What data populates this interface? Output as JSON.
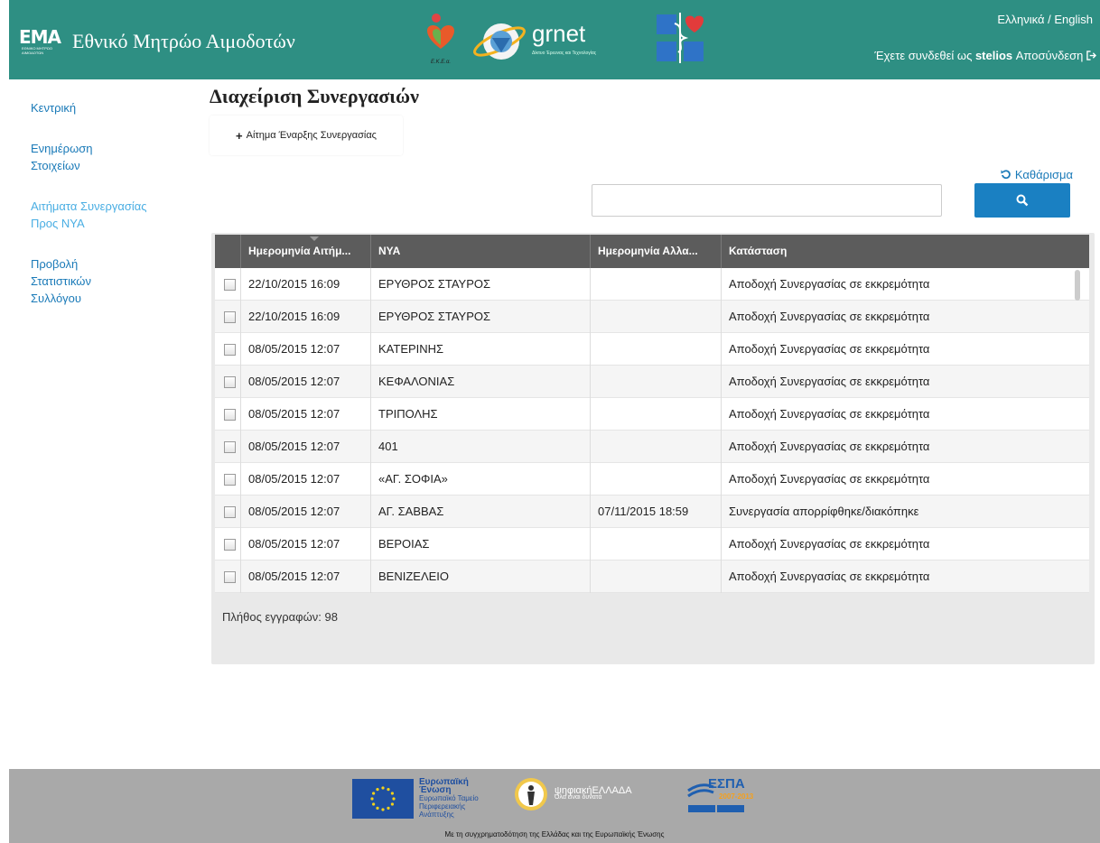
{
  "header": {
    "logo_abbr": "EMA",
    "logo_tiny": "ΕΘΝΙΚΟ ΜΗΤΡΩΟ ΑΙΜΟΔΟΤΩΝ",
    "title": "Εθνικό Μητρώο Αιμοδοτών",
    "partner_ekea": "Ε.Κ.Ε.α.",
    "partner_grnet": "grnet",
    "partner_grnet_sub": "Δίκτυο Έρευνας και Τεχνολογίας",
    "lang_el": "Ελληνικά",
    "lang_sep": " / ",
    "lang_en": "English",
    "login_prefix": "Έχετε συνδεθεί ως ",
    "login_user": "stelios",
    "logout": "Αποσύνδεση"
  },
  "sidebar": {
    "items": [
      {
        "label": "Κεντρική",
        "active": false
      },
      {
        "label": "Ενημέρωση Στοιχείων",
        "active": false
      },
      {
        "label": "Αιτήματα Συνεργασίας Προς ΝΥΑ",
        "active": true
      },
      {
        "label": "Προβολή Στατιστικών Συλλόγου",
        "active": false
      }
    ]
  },
  "main": {
    "title": "Διαχείριση Συνεργασιών",
    "request_button": "Αίτημα Έναρξης Συνεργασίας",
    "clear_label": "Καθάρισμα",
    "search_value": "",
    "search_placeholder": ""
  },
  "grid": {
    "columns": [
      "Ημερομηνία Αιτήμ...",
      "ΝΥΑ",
      "Ημερομηνία Αλλα...",
      "Κατάσταση"
    ],
    "rows": [
      [
        "22/10/2015 16:09",
        "ΕΡΥΘΡΟΣ ΣΤΑΥΡΟΣ",
        "",
        "Αποδοχή Συνεργασίας σε εκκρεμότητα"
      ],
      [
        "22/10/2015 16:09",
        "ΕΡΥΘΡΟΣ ΣΤΑΥΡΟΣ",
        "",
        "Αποδοχή Συνεργασίας σε εκκρεμότητα"
      ],
      [
        "08/05/2015 12:07",
        "ΚΑΤΕΡΙΝΗΣ",
        "",
        "Αποδοχή Συνεργασίας σε εκκρεμότητα"
      ],
      [
        "08/05/2015 12:07",
        "ΚΕΦΑΛΟΝΙΑΣ",
        "",
        "Αποδοχή Συνεργασίας σε εκκρεμότητα"
      ],
      [
        "08/05/2015 12:07",
        "ΤΡΙΠΟΛΗΣ",
        "",
        "Αποδοχή Συνεργασίας σε εκκρεμότητα"
      ],
      [
        "08/05/2015 12:07",
        "401",
        "",
        "Αποδοχή Συνεργασίας σε εκκρεμότητα"
      ],
      [
        "08/05/2015 12:07",
        "«ΑΓ. ΣΟΦΙΑ»",
        "",
        "Αποδοχή Συνεργασίας σε εκκρεμότητα"
      ],
      [
        "08/05/2015 12:07",
        "ΑΓ. ΣΑΒΒΑΣ",
        "07/11/2015 18:59",
        "Συνεργασία απορρίφθηκε/διακόπηκε"
      ],
      [
        "08/05/2015 12:07",
        "ΒΕΡΟΙΑΣ",
        "",
        "Αποδοχή Συνεργασίας σε εκκρεμότητα"
      ],
      [
        "08/05/2015 12:07",
        "ΒΕΝΙΖΕΛΕΙΟ",
        "",
        "Αποδοχή Συνεργασίας σε εκκρεμότητα"
      ]
    ],
    "record_count": "Πλήθος εγγραφών: 98"
  },
  "footer": {
    "eu_title": "Ευρωπαϊκή Ένωση",
    "eu_sub": "Ευρωπαϊκό Ταμείο Περιφερειακής Ανάπτυξης",
    "digital_title": "ψηφιακήΕΛΛΑΔΑ",
    "digital_sub": "Όλα είναι δυνατά",
    "espa": "ΕΣΠΑ",
    "espa_years": "2007-2013",
    "note": "Με τη συγχρηματοδότηση της Ελλάδας και της Ευρωπαϊκής Ένωσης"
  },
  "colors": {
    "header_bg": "#2e8f83",
    "link": "#1a7ab8",
    "active_link": "#4aaee3",
    "search_button": "#1a80c2",
    "grid_header": "#5c5c5c",
    "footer_bg": "#a9a9a9"
  },
  "icons": {
    "plus": "plus-icon",
    "refresh": "refresh-icon",
    "search": "search-icon",
    "logout": "logout-icon"
  }
}
